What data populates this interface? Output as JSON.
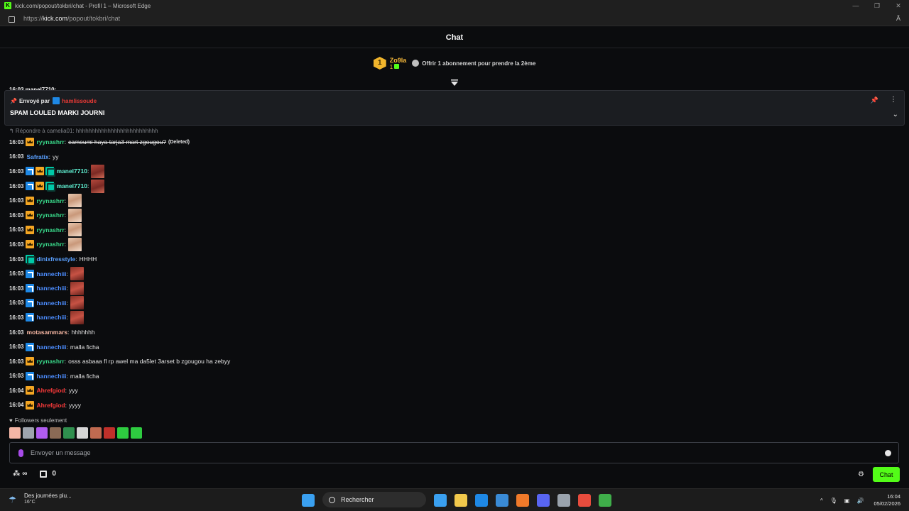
{
  "window": {
    "title": "kick.com/popout/tokbri/chat - Profil 1 – Microsoft Edge",
    "logo_letter": "K",
    "url_prefix": "https://",
    "url_host": "kick.com",
    "url_path": "/popout/tokbri/chat",
    "read_aloud": "Ă"
  },
  "chat": {
    "title": "Chat",
    "sub_leader": {
      "rank": "1",
      "username": "Zo9la",
      "count": "1",
      "offer_text": "Offrir 1 abonnement pour prendre la 2ème"
    },
    "pinned": {
      "sent_by_label": "Envoyé par",
      "sent_by_user": "hamlissoude",
      "message": "SPAM LOULED MARKI JOURNI"
    },
    "cut_row": "16:03 manel7710:",
    "reply_text": "↰ Répondre à camelia01: hhhhhhhhhhhhhhhhhhhhhhhhhh",
    "messages": [
      {
        "time": "16:03",
        "badges": [
          "crown"
        ],
        "user": "ryynashrr",
        "color": "#39d98a",
        "text": "camoumi haya tarja3 mart zgougou?",
        "deleted": true,
        "deleted_tag": "(Deleted)"
      },
      {
        "time": "16:03",
        "badges": [],
        "user": "Safratix",
        "color": "#5aa0ff",
        "text": "yy"
      },
      {
        "time": "16:03",
        "badges": [
          "verified",
          "crown",
          "og"
        ],
        "user": "manel7710",
        "color": "#5ff0d2",
        "emote": "e1"
      },
      {
        "time": "16:03",
        "badges": [
          "verified",
          "crown",
          "og"
        ],
        "user": "manel7710",
        "color": "#5ff0d2",
        "emote": "e1"
      },
      {
        "time": "16:03",
        "badges": [
          "crown"
        ],
        "user": "ryynashrr",
        "color": "#39d98a",
        "emote": "e2"
      },
      {
        "time": "16:03",
        "badges": [
          "crown"
        ],
        "user": "ryynashrr",
        "color": "#39d98a",
        "emote": "e2"
      },
      {
        "time": "16:03",
        "badges": [
          "crown"
        ],
        "user": "ryynashrr",
        "color": "#39d98a",
        "emote": "e2"
      },
      {
        "time": "16:03",
        "badges": [
          "crown"
        ],
        "user": "ryynashrr",
        "color": "#39d98a",
        "emote": "e2"
      },
      {
        "time": "16:03",
        "badges": [
          "og"
        ],
        "user": "dinixfresstyle",
        "color": "#5aa0ff",
        "text": "HHHH"
      },
      {
        "time": "16:03",
        "badges": [
          "verified"
        ],
        "user": "hannechiii",
        "color": "#4c8dff",
        "emote": "e3"
      },
      {
        "time": "16:03",
        "badges": [
          "verified"
        ],
        "user": "hannechiii",
        "color": "#4c8dff",
        "emote": "e3"
      },
      {
        "time": "16:03",
        "badges": [
          "verified"
        ],
        "user": "hannechiii",
        "color": "#4c8dff",
        "emote": "e3"
      },
      {
        "time": "16:03",
        "badges": [
          "verified"
        ],
        "user": "hannechiii",
        "color": "#4c8dff",
        "emote": "e3"
      },
      {
        "time": "16:03",
        "badges": [],
        "user": "motasammars",
        "color": "#f7b7a3",
        "text": "hhhhhhh"
      },
      {
        "time": "16:03",
        "badges": [
          "verified"
        ],
        "user": "hannechiii",
        "color": "#4c8dff",
        "text": "malla ficha"
      },
      {
        "time": "16:03",
        "badges": [
          "crown"
        ],
        "user": "ryynashrr",
        "color": "#39d98a",
        "text": "osss asbaaa fl rp awel ma da5let 3arset b zgougou ha zebyy"
      },
      {
        "time": "16:03",
        "badges": [
          "verified"
        ],
        "user": "hannechiii",
        "color": "#4c8dff",
        "text": "malla ficha"
      },
      {
        "time": "16:04",
        "badges": [
          "crown"
        ],
        "user": "Ahrefgiod",
        "color": "#ff3b3b",
        "text": "yyy"
      },
      {
        "time": "16:04",
        "badges": [
          "crown"
        ],
        "user": "Ahrefgiod",
        "color": "#ff3b3b",
        "text": "yyyy"
      }
    ],
    "mode_label": "Followers seulement",
    "emote_bar": [
      "#f3b6a6",
      "#9ea4ad",
      "#b05cf0",
      "#8a6a55",
      "#2f8f4e",
      "#d6d6d6",
      "#c06a50",
      "#c0302a",
      "#2ecc40",
      "#2ecc40"
    ],
    "input_placeholder": "Envoyer un message",
    "infinity": "∞",
    "points": "0",
    "chat_button": "Chat"
  },
  "taskbar": {
    "weather_text": "Des journées plu...",
    "weather_temp": "16°C",
    "search_label": "Rechercher",
    "time": "16:04",
    "date": "05/02/2026",
    "app_colors": [
      "#3aa0f0",
      "#f2c94c",
      "#1e88e5",
      "#3a8bd6",
      "#f07a2a",
      "#5865f2",
      "#9aa3ad",
      "#e84c3d",
      "#3fae4a"
    ]
  },
  "colors": {
    "accent": "#53fc18",
    "background": "#0b0c0e"
  }
}
